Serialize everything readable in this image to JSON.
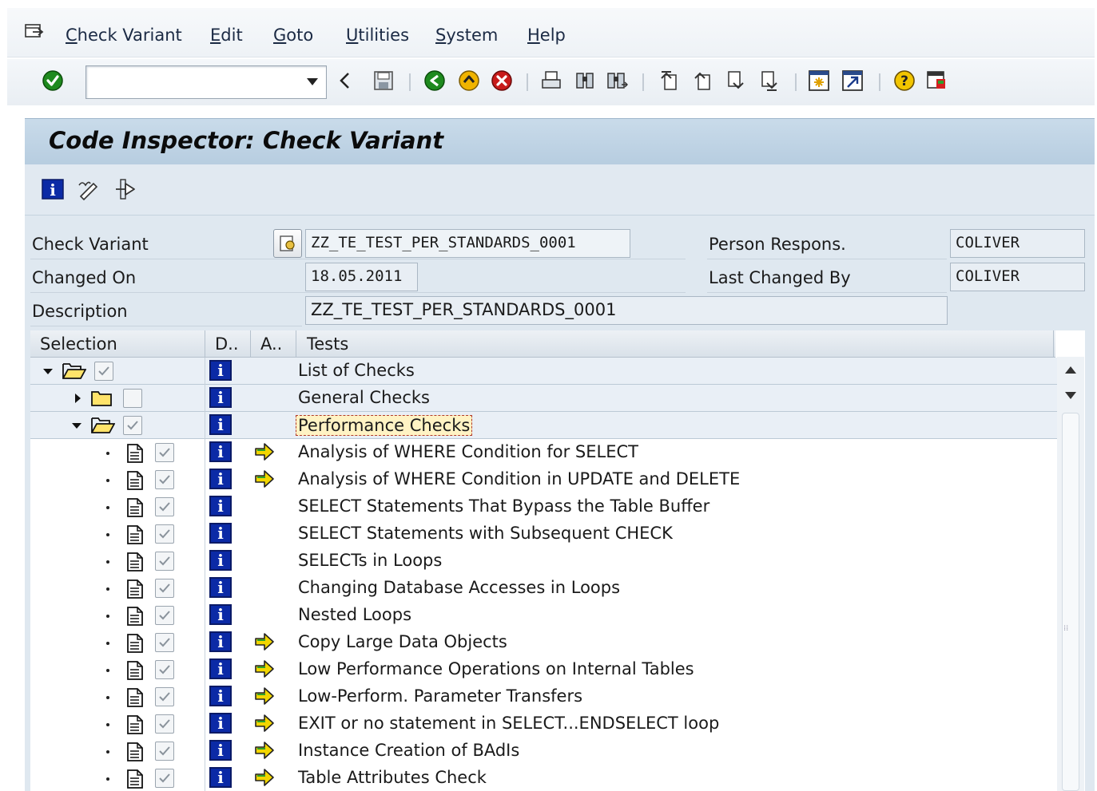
{
  "menu": {
    "items": [
      {
        "label": "Check Variant",
        "u": "C",
        "rest": "heck Variant"
      },
      {
        "label": "Edit",
        "u": "E",
        "rest": "dit"
      },
      {
        "label": "Goto",
        "u": "G",
        "rest": "oto"
      },
      {
        "label": "Utilities",
        "u": "U",
        "rest": "tilities"
      },
      {
        "label": "System",
        "u": "S",
        "rest": "ystem"
      },
      {
        "label": "Help",
        "u": "H",
        "rest": "elp"
      }
    ]
  },
  "toolbar": {
    "command_value": "",
    "icons": [
      "enter-icon",
      "back-nav-icon",
      "save-icon",
      "back-icon",
      "exit-icon",
      "cancel-icon",
      "print-icon",
      "find-icon",
      "find-next-icon",
      "first-page-icon",
      "previous-page-icon",
      "next-page-icon",
      "last-page-icon",
      "create-session-icon",
      "shortcut-icon",
      "help-icon",
      "customize-layout-icon"
    ]
  },
  "title": "Code Inspector: Check Variant",
  "form": {
    "check_variant_label": "Check Variant",
    "check_variant_value": "ZZ_TE_TEST_PER_STANDARDS_0001",
    "changed_on_label": "Changed On",
    "changed_on_value": "18.05.2011",
    "description_label": "Description",
    "description_value": "ZZ_TE_TEST_PER_STANDARDS_0001",
    "person_label": "Person Respons.",
    "person_value": "COLIVER",
    "last_changed_label": "Last Changed By",
    "last_changed_value": "COLIVER"
  },
  "tree": {
    "headers": {
      "selection": "Selection",
      "doc": "D..",
      "attr": "A..",
      "tests": "Tests"
    },
    "rows": [
      {
        "level": 0,
        "type": "folder-open",
        "expanded": true,
        "checked": true,
        "has_attr": false,
        "text": "List of Checks",
        "highlight": true
      },
      {
        "level": 1,
        "type": "folder",
        "expanded": false,
        "checked": false,
        "has_attr": false,
        "text": "General Checks",
        "highlight": true
      },
      {
        "level": 1,
        "type": "folder-open",
        "expanded": true,
        "checked": true,
        "has_attr": false,
        "text": "Performance Checks",
        "highlight": true,
        "focused": true
      },
      {
        "level": 2,
        "type": "doc",
        "checked": true,
        "has_attr": true,
        "text": "Analysis of WHERE Condition for SELECT"
      },
      {
        "level": 2,
        "type": "doc",
        "checked": true,
        "has_attr": true,
        "text": "Analysis of WHERE Condition in UPDATE and DELETE"
      },
      {
        "level": 2,
        "type": "doc",
        "checked": true,
        "has_attr": false,
        "text": "SELECT Statements That Bypass the Table Buffer"
      },
      {
        "level": 2,
        "type": "doc",
        "checked": true,
        "has_attr": false,
        "text": "SELECT Statements with Subsequent CHECK"
      },
      {
        "level": 2,
        "type": "doc",
        "checked": true,
        "has_attr": false,
        "text": "SELECTs in Loops"
      },
      {
        "level": 2,
        "type": "doc",
        "checked": true,
        "has_attr": false,
        "text": "Changing Database Accesses in Loops"
      },
      {
        "level": 2,
        "type": "doc",
        "checked": true,
        "has_attr": false,
        "text": "Nested Loops"
      },
      {
        "level": 2,
        "type": "doc",
        "checked": true,
        "has_attr": true,
        "text": "Copy Large Data Objects"
      },
      {
        "level": 2,
        "type": "doc",
        "checked": true,
        "has_attr": true,
        "text": "Low Performance Operations on Internal Tables"
      },
      {
        "level": 2,
        "type": "doc",
        "checked": true,
        "has_attr": true,
        "text": "Low-Perform. Parameter Transfers"
      },
      {
        "level": 2,
        "type": "doc",
        "checked": true,
        "has_attr": true,
        "text": "EXIT or no statement in SELECT...ENDSELECT loop"
      },
      {
        "level": 2,
        "type": "doc",
        "checked": true,
        "has_attr": true,
        "text": "Instance Creation of BAdIs"
      },
      {
        "level": 2,
        "type": "doc",
        "checked": true,
        "has_attr": true,
        "text": "Table Attributes Check"
      }
    ]
  },
  "colors": {
    "title_bg": "#c3d6e7",
    "content_bg": "#dfe8f0",
    "info_icon": "#0b2aa6",
    "arrow_icon": "#f2d600"
  }
}
